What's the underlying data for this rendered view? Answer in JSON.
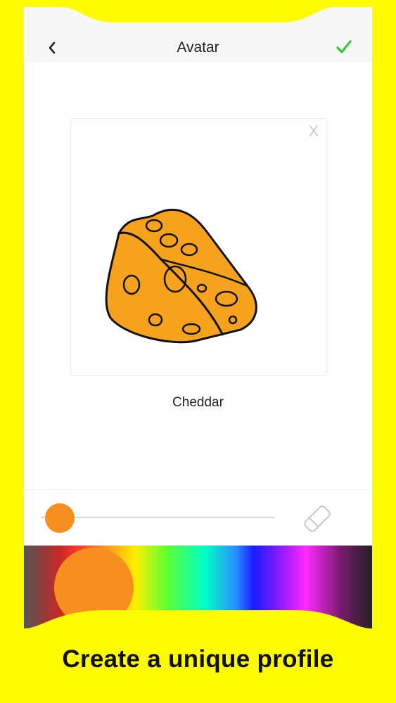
{
  "header": {
    "back_icon": "chevron-left-icon",
    "title": "Avatar",
    "confirm_icon": "checkmark-icon",
    "confirm_color": "#2ecc40"
  },
  "avatar_card": {
    "close_label": "X",
    "drawing": "cheese-wedge-drawing",
    "name": "Cheddar"
  },
  "brush": {
    "size_level": 0.08,
    "color": "#f78f1e",
    "eraser_icon": "eraser-icon"
  },
  "palette": {
    "selected_color": "#f78f1e"
  },
  "caption": "Create a unique profile",
  "colors": {
    "background": "#fffb00",
    "accent_orange": "#f78f1e"
  }
}
